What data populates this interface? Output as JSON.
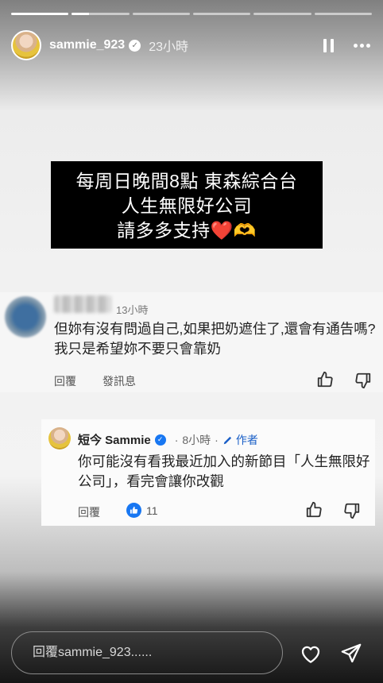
{
  "progress": {
    "segments": 6,
    "fills": [
      1,
      0.3,
      0,
      0,
      0,
      0
    ]
  },
  "header": {
    "username": "sammie_923",
    "time_ago": "23小時"
  },
  "promo": {
    "line1": "每周日晚間8點 東森綜合台",
    "line2": "人生無限好公司",
    "line3": "請多多支持❤️🫶"
  },
  "comment1": {
    "time": "13小時",
    "text": "但妳有沒有問過自己,如果把奶遮住了,還會有通告嗎? 我只是希望妳不要只會靠奶",
    "reply_label": "回覆",
    "message_label": "發訊息"
  },
  "comment2": {
    "name": "短今 Sammie",
    "time": "8小時",
    "author_label": "作者",
    "text": "你可能沒有看我最近加入的新節目「人生無限好公司」，看完會讓你改觀",
    "reply_label": "回覆",
    "like_count": "11"
  },
  "reply_bar": {
    "placeholder": "回覆sammie_923......"
  },
  "icons": {
    "verified": "verified-badge-icon",
    "pause": "pause-icon",
    "more": "more-icon",
    "thumb_up": "thumb-up-icon",
    "thumb_down": "thumb-down-icon",
    "heart": "heart-icon",
    "send": "send-icon",
    "edit": "pencil-icon"
  },
  "colors": {
    "accent_blue": "#1877f2",
    "author_blue": "#1a5fc7",
    "promo_bg": "#000000"
  }
}
